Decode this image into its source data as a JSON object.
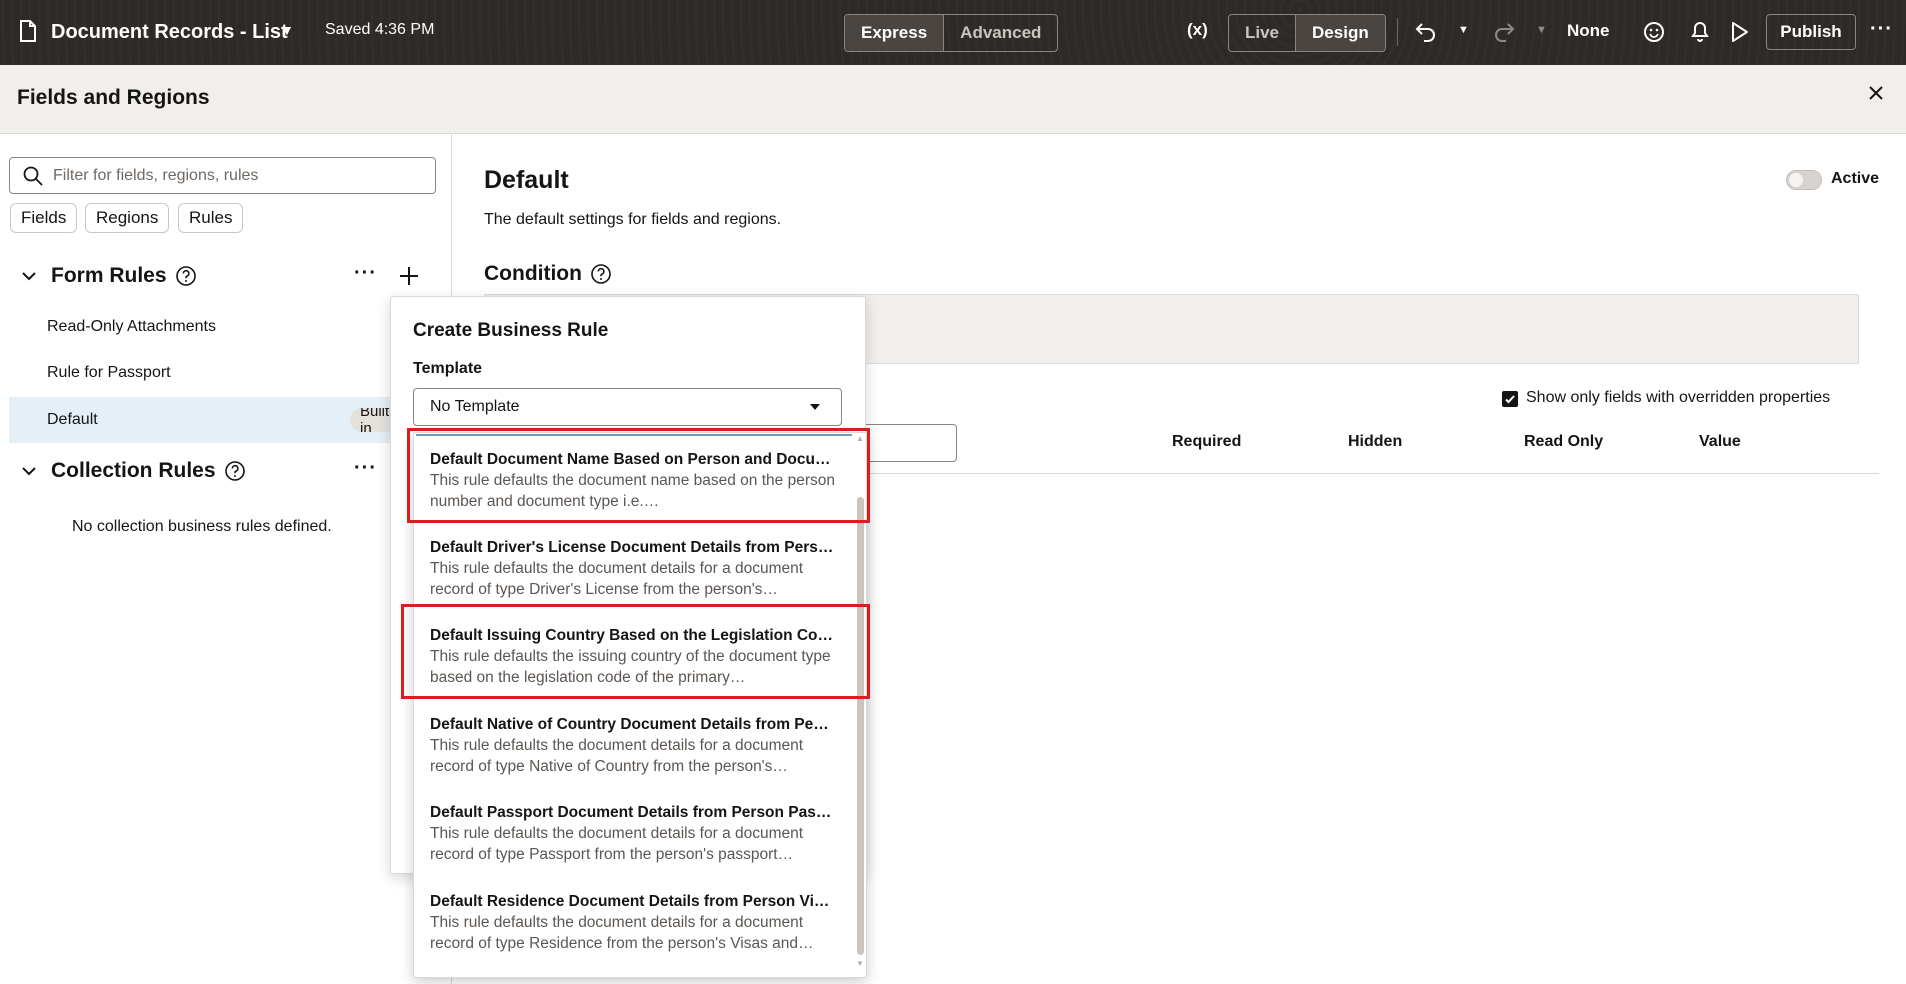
{
  "topbar": {
    "app_title": "Document Records - List",
    "saved_status": "Saved 4:36 PM",
    "mode_tabs": [
      "Express",
      "Advanced"
    ],
    "view_tabs": [
      "Live",
      "Design"
    ],
    "vars_glyph": "(x)",
    "role_selector": "None",
    "publish_label": "Publish",
    "more_glyph": "···"
  },
  "panel": {
    "title": "Fields and Regions",
    "close_icon": "close-icon"
  },
  "left": {
    "search_placeholder": "Filter for fields, regions, rules",
    "filter_chips": [
      "Fields",
      "Regions",
      "Rules"
    ],
    "form_rules_title": "Form Rules",
    "form_rules": [
      "Read-Only Attachments",
      "Rule for Passport",
      "Default"
    ],
    "default_badge": "Built-in",
    "collection_rules_title": "Collection Rules",
    "no_collection_rules": "No collection business rules defined."
  },
  "right": {
    "title": "Default",
    "description": "The default settings for fields and regions.",
    "active_label": "Active",
    "condition_title": "Condition",
    "show_overridden_label": "Show only fields with overridden properties",
    "columns": [
      "Required",
      "Hidden",
      "Read Only",
      "Value"
    ]
  },
  "popup": {
    "title": "Create Business Rule",
    "template_label": "Template",
    "template_value": "No Template",
    "templates": [
      {
        "title": "Default Document Name Based on Person and Document Type",
        "desc": "This rule defaults the document name based on the person number and document type i.e.…"
      },
      {
        "title": "Default Driver's License Document Details from Person Driver's License",
        "desc": "This rule defaults the document details for a document record of type Driver's License from the person's…"
      },
      {
        "title": "Default Issuing Country Based on the Legislation Code",
        "desc": "This rule defaults the issuing country of the document type based on the legislation code of the primary…"
      },
      {
        "title": "Default Native of Country Document Details from Person Citizenship",
        "desc": "This rule defaults the document details for a document record of type Native of Country from the person's…"
      },
      {
        "title": "Default Passport Document Details from Person Passport",
        "desc": "This rule defaults the document details for a document record of type Passport from the person's passport…"
      },
      {
        "title": "Default Residence Document Details from Person Visas and Permits",
        "desc": "This rule defaults the document details for a document record of type Residence from the person's Visas and…"
      }
    ]
  },
  "colors": {
    "topbar_bg": "#2e2a27",
    "highlight_border": "#d81f1f",
    "selected_row": "#e4eff7"
  }
}
